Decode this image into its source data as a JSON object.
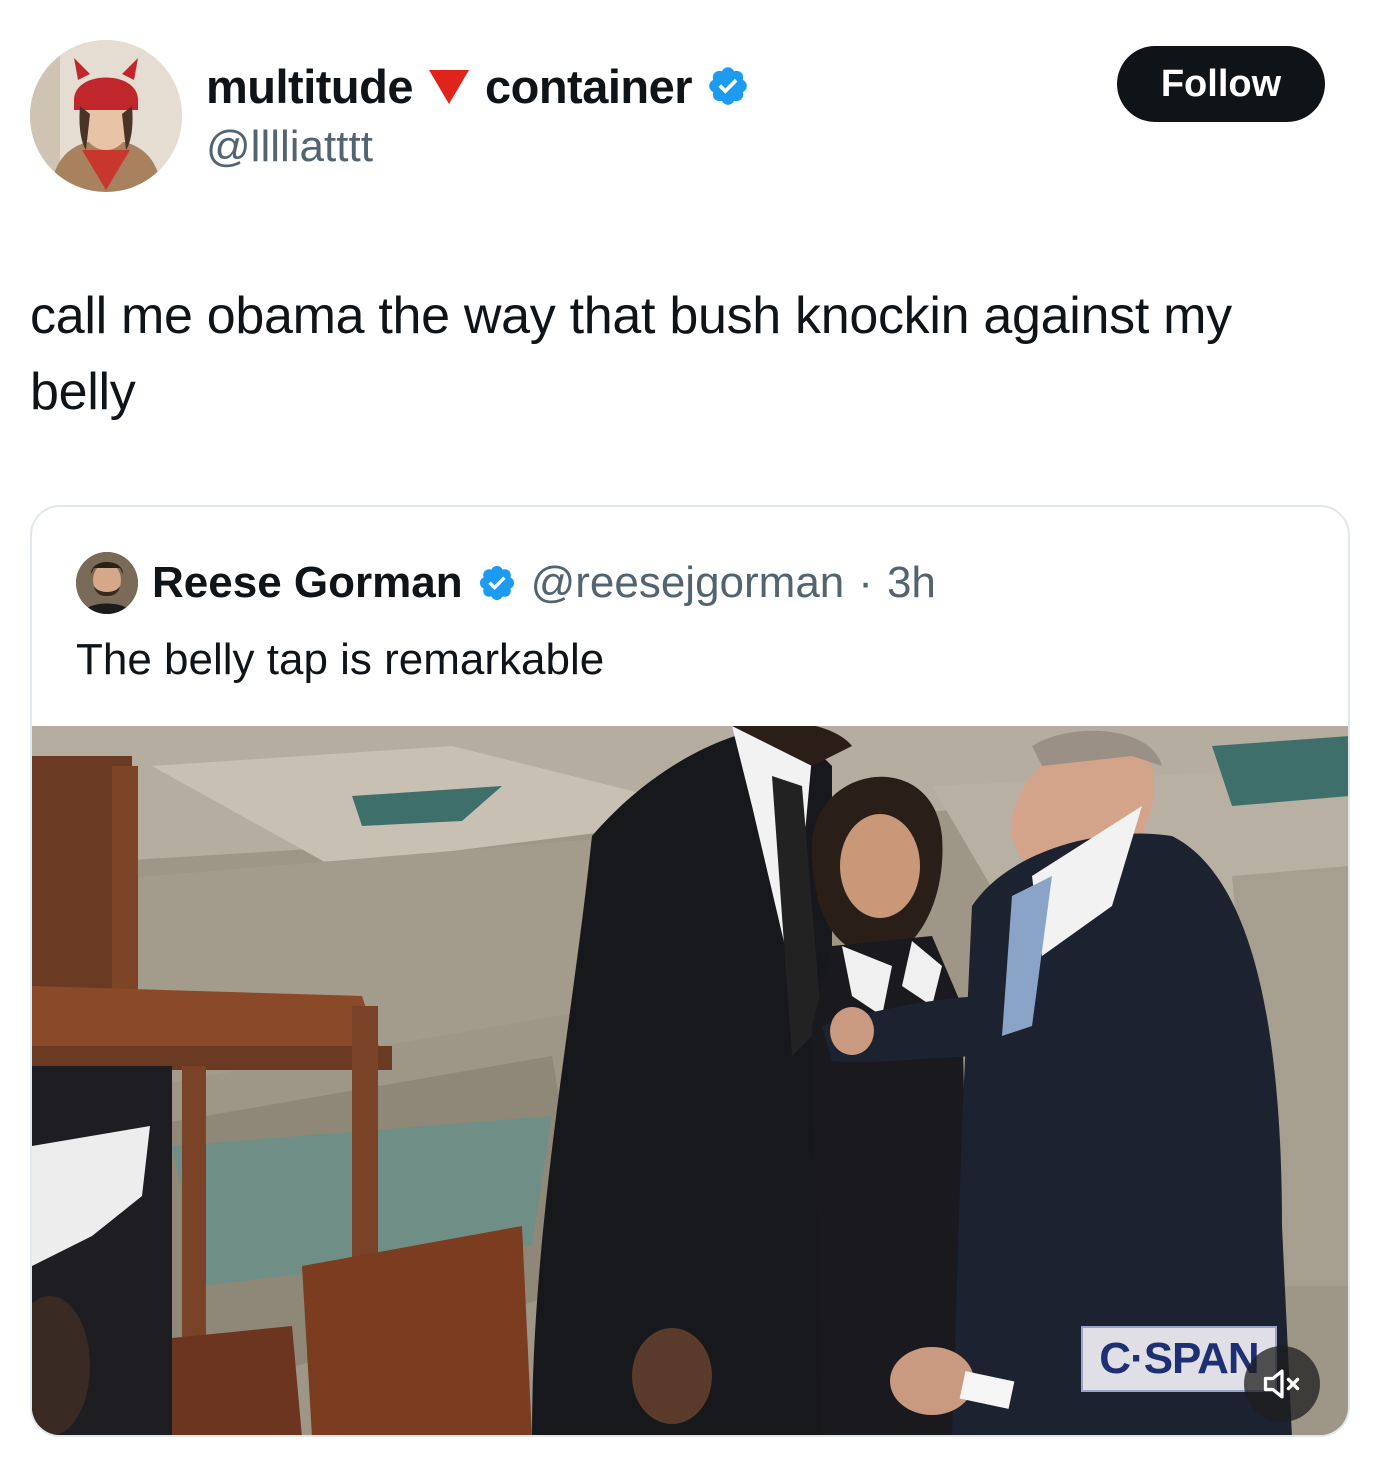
{
  "author": {
    "name_part1": "multitude",
    "name_part2": "container",
    "handle": "@lllliatttt",
    "name_emoji": "red-triangle-down-icon",
    "verified": true
  },
  "follow_button": {
    "label": "Follow"
  },
  "tweet": {
    "text": "call me obama the way that bush knockin against my belly"
  },
  "quoted": {
    "name": "Reese Gorman",
    "verified": true,
    "handle": "@reesejgorman",
    "separator": "·",
    "time": "3h",
    "text": "The belly tap is remarkable",
    "media": {
      "watermark": "C·SPAN",
      "mute_icon": "speaker-muted-icon"
    }
  },
  "colors": {
    "accent": "#1d9bf0",
    "text": "#0f1419",
    "secondary_text": "#536471",
    "follow_bg": "#0f1419",
    "triangle": "#e0241b"
  }
}
